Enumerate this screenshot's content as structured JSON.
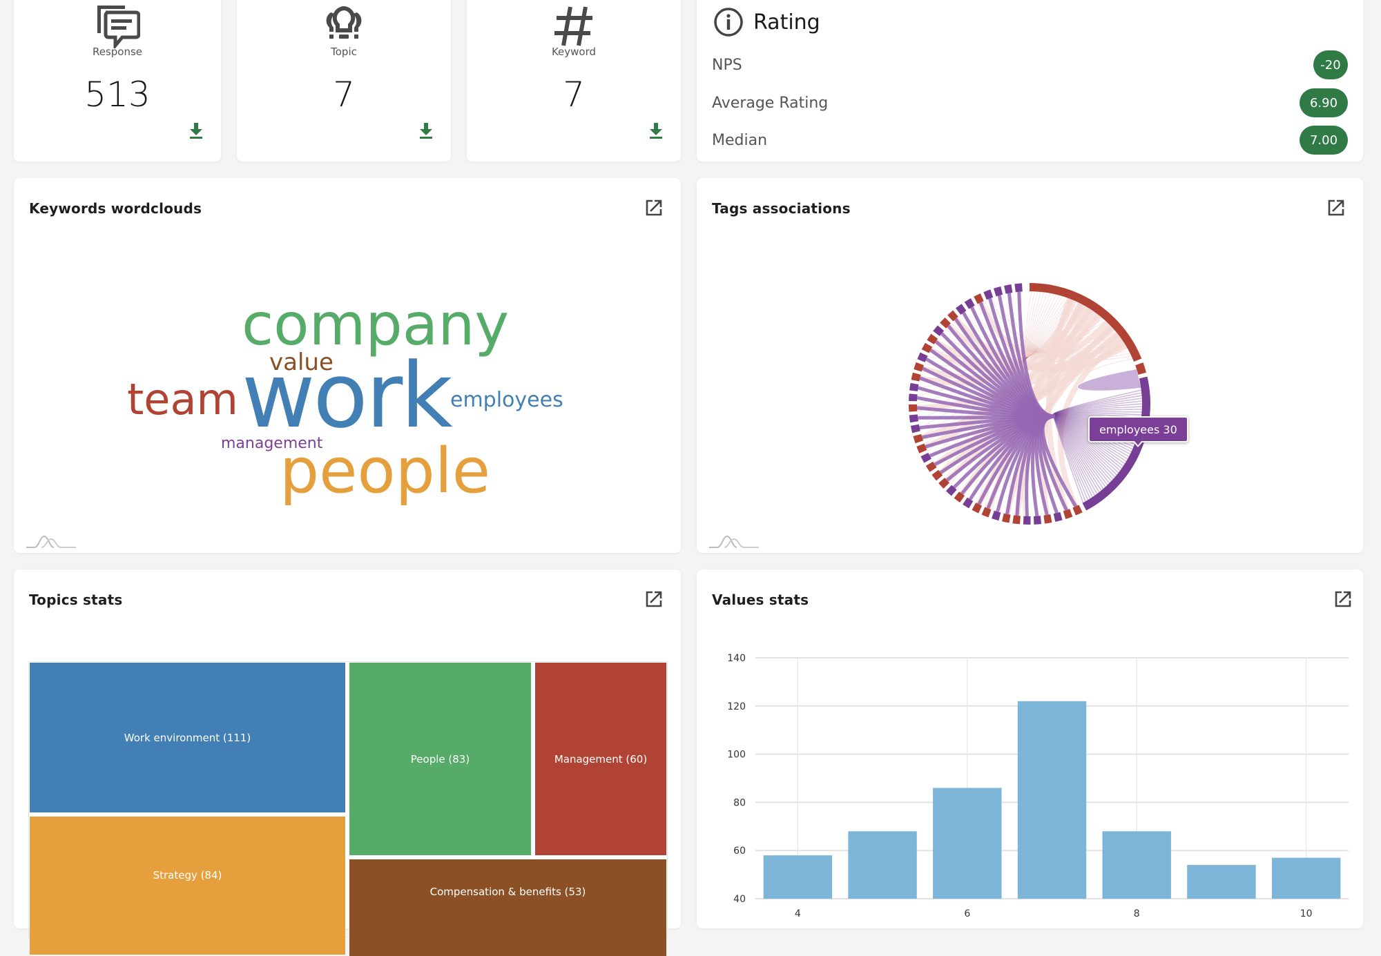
{
  "stats": [
    {
      "id": "response",
      "icon": "chat-bubbles-icon",
      "label": "Response",
      "value": "513"
    },
    {
      "id": "topic",
      "icon": "lightbulbs-icon",
      "label": "Topic",
      "value": "7"
    },
    {
      "id": "keyword",
      "icon": "hashtag-icon",
      "label": "Keyword",
      "value": "7"
    }
  ],
  "rating": {
    "title": "Rating",
    "icon": "info-icon",
    "rows": [
      {
        "label": "NPS",
        "value": "-20"
      },
      {
        "label": "Average Rating",
        "value": "6.90"
      },
      {
        "label": "Median",
        "value": "7.00"
      }
    ],
    "badge_color": "#2f7a45"
  },
  "panels": {
    "wordcloud": {
      "title": "Keywords wordclouds"
    },
    "tags": {
      "title": "Tags associations"
    },
    "topics": {
      "title": "Topics stats"
    },
    "values": {
      "title": "Values stats"
    }
  },
  "wordcloud": {
    "words": [
      {
        "text": "company",
        "color": "#55ab67",
        "weight": 5
      },
      {
        "text": "value",
        "color": "#8b4f22",
        "weight": 2
      },
      {
        "text": "team",
        "color": "#b14335",
        "weight": 4
      },
      {
        "text": "work",
        "color": "#427fb4",
        "weight": 7
      },
      {
        "text": "employees",
        "color": "#427fb4",
        "weight": 2
      },
      {
        "text": "management",
        "color": "#7b3f98",
        "weight": 1
      },
      {
        "text": "people",
        "color": "#e5a03d",
        "weight": 5
      }
    ]
  },
  "tags_chord": {
    "tooltip": "employees 30",
    "colors": {
      "red": "#b14335",
      "purple": "#763e95"
    }
  },
  "chart_data": [
    {
      "type": "heatmap",
      "subtype": "treemap",
      "title": "Topics stats",
      "categories": [
        "Work environment",
        "Strategy",
        "People",
        "Management",
        "Compensation & benefits"
      ],
      "values": [
        111,
        84,
        83,
        60,
        53
      ],
      "labels": [
        "Work environment (111)",
        "Strategy (84)",
        "People (83)",
        "Management (60)",
        "Compensation & benefits (53)"
      ],
      "colors": [
        "#427fb4",
        "#e5a03d",
        "#55ab67",
        "#b14335",
        "#8b5025"
      ]
    },
    {
      "type": "bar",
      "title": "Values stats",
      "categories": [
        4,
        5,
        6,
        7,
        8,
        9,
        10
      ],
      "values": [
        58,
        68,
        86,
        122,
        68,
        54,
        57
      ],
      "xticks": [
        "4",
        "6",
        "8",
        "10"
      ],
      "yticks": [
        "40",
        "60",
        "80",
        "100",
        "120",
        "140"
      ],
      "ylim": [
        40,
        140
      ],
      "xlabel": "",
      "ylabel": "",
      "grid": true,
      "bar_color": "#7cb5d7"
    }
  ]
}
